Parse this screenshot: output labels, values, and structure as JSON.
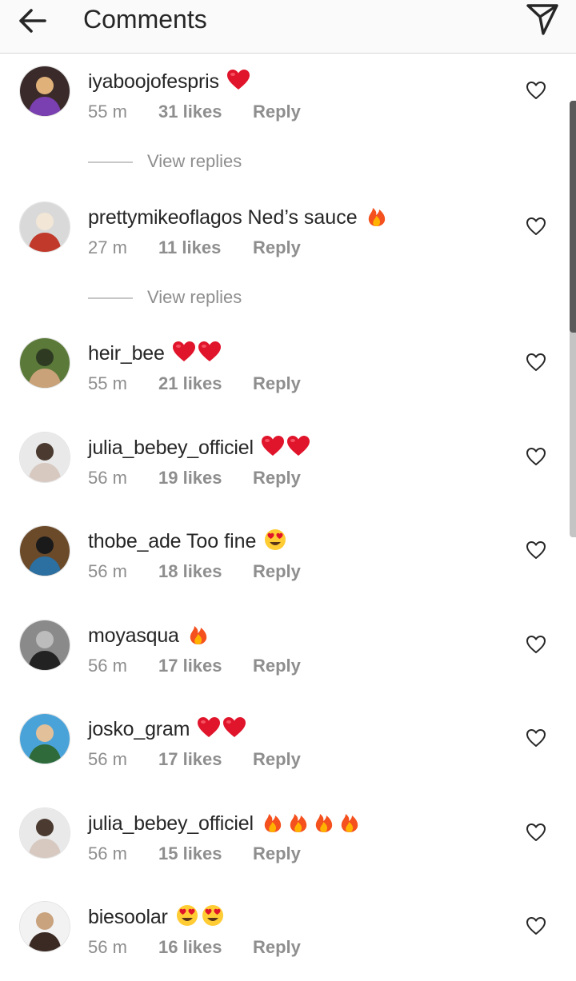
{
  "header": {
    "title": "Comments",
    "back_icon": "arrow-left-icon",
    "send_icon": "paper-plane-icon"
  },
  "colors": {
    "meta": "#8e8e8e",
    "text": "#262626",
    "heart": "#e0142b",
    "header_bg": "#fafafa"
  },
  "view_replies_label": "View replies",
  "comments": [
    {
      "username": "iyaboojofespris",
      "text": "",
      "emoji": [
        "red-heart"
      ],
      "time": "55 m",
      "likes": "31 likes",
      "reply": "Reply",
      "view_replies": true
    },
    {
      "username": "prettymikeoflagos",
      "text": "Ned’s sauce",
      "emoji": [
        "fire"
      ],
      "time": "27 m",
      "likes": "11 likes",
      "reply": "Reply",
      "view_replies": true
    },
    {
      "username": "heir_bee",
      "text": "",
      "emoji": [
        "red-heart",
        "red-heart"
      ],
      "time": "55 m",
      "likes": "21 likes",
      "reply": "Reply",
      "view_replies": false
    },
    {
      "username": "julia_bebey_officiel",
      "text": "",
      "emoji": [
        "red-heart",
        "red-heart"
      ],
      "time": "56 m",
      "likes": "19 likes",
      "reply": "Reply",
      "view_replies": false
    },
    {
      "username": "thobe_ade",
      "text": "Too fine",
      "emoji": [
        "heart-eyes"
      ],
      "time": "56 m",
      "likes": "18 likes",
      "reply": "Reply",
      "view_replies": false
    },
    {
      "username": "moyasqua",
      "text": "",
      "emoji": [
        "fire"
      ],
      "time": "56 m",
      "likes": "17 likes",
      "reply": "Reply",
      "view_replies": false
    },
    {
      "username": "josko_gram",
      "text": "",
      "emoji": [
        "red-heart",
        "red-heart"
      ],
      "time": "56 m",
      "likes": "17 likes",
      "reply": "Reply",
      "view_replies": false
    },
    {
      "username": "julia_bebey_officiel",
      "text": "",
      "emoji": [
        "fire",
        "fire",
        "fire",
        "fire"
      ],
      "time": "56 m",
      "likes": "15 likes",
      "reply": "Reply",
      "view_replies": false
    },
    {
      "username": "biesoolar",
      "text": "",
      "emoji": [
        "heart-eyes",
        "heart-eyes"
      ],
      "time": "56 m",
      "likes": "16 likes",
      "reply": "Reply",
      "view_replies": false
    }
  ]
}
